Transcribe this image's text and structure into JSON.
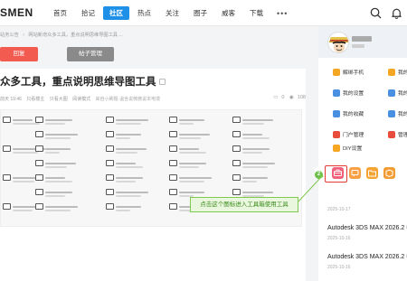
{
  "header": {
    "logo": "SMEN",
    "nav": [
      "首页",
      "拾记",
      "社区",
      "热点",
      "关注",
      "圈子",
      "威客",
      "下载"
    ],
    "active_nav": "社区",
    "more": "•••",
    "icons": [
      "search-icon",
      "bell-icon"
    ]
  },
  "breadcrumb": [
    "站务公告",
    "网站新增众多工具，重点说明思维导图工具 ..."
  ],
  "actions": {
    "primary": "回复",
    "secondary": "帖子管理"
  },
  "post": {
    "title": "众多工具，重点说明思维导图工具",
    "meta": {
      "time": "前天 19:46",
      "author_tags": [
        "只看楼主",
        "只看大图",
        "阅读模式"
      ],
      "keywords": "来自小刷题·温含说微微说本电境"
    },
    "stats": {
      "comments": "0",
      "views": "108"
    }
  },
  "sidebar_menu": [
    {
      "label": "解绑手机",
      "color": "#f5a623"
    },
    {
      "label": "我的",
      "color": "#f5a623"
    },
    {
      "label": "我的设置",
      "color": "#4a90e2"
    },
    {
      "label": "我的",
      "color": "#4a90e2"
    },
    {
      "label": "我的收藏",
      "color": "#4a90e2"
    },
    {
      "label": "我的",
      "color": "#4a90e2"
    },
    {
      "label": "门户管理",
      "color": "#e74c3c"
    },
    {
      "label": "管理",
      "color": "#e74c3c"
    },
    {
      "label": "DIY设置",
      "color": "#f5a623"
    }
  ],
  "toolbar_badge": "2",
  "callout": "点击这个图标进入工具箱使用工具",
  "downloads": [
    {
      "date": "2025-10-17",
      "title": "Autodesk 3DS MAX 2026.2 中文"
    },
    {
      "date": "2025-10-16",
      "title": "Autodesk 3DS MAX 2026.2 中文"
    },
    {
      "date": "2025-10-16",
      "title": ""
    }
  ]
}
